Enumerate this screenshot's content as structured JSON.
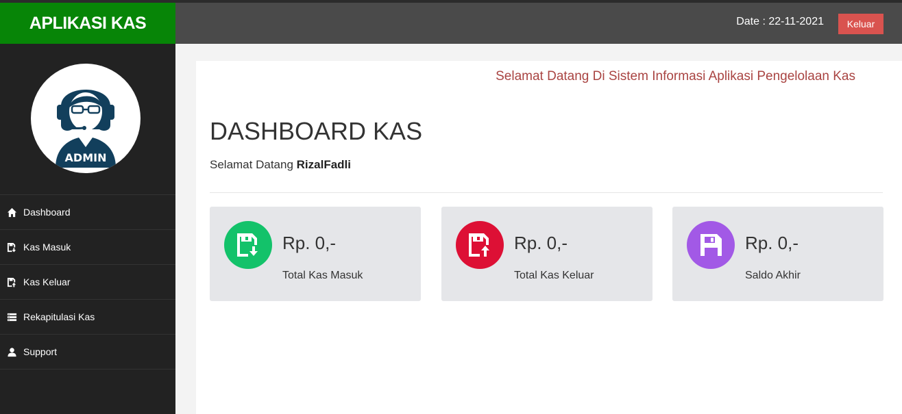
{
  "brand": "APLIKASI KAS",
  "header": {
    "date_text": "Date : 22-11-2021",
    "logout_label": "Keluar"
  },
  "sidebar": {
    "avatar_label": "ADMIN",
    "items": [
      {
        "label": "Dashboard",
        "icon": "home-icon"
      },
      {
        "label": "Kas Masuk",
        "icon": "cash-in-icon"
      },
      {
        "label": "Kas Keluar",
        "icon": "cash-out-icon"
      },
      {
        "label": "Rekapitulasi Kas",
        "icon": "list-icon"
      },
      {
        "label": "Support",
        "icon": "user-icon"
      }
    ]
  },
  "main": {
    "marquee": "Selamat Datang Di Sistem Informasi Aplikasi Pengelolaan Kas",
    "title": "DASHBOARD KAS",
    "welcome_prefix": "Selamat Datang ",
    "username": "RizalFadli",
    "cards": [
      {
        "value": "Rp. 0,-",
        "label": "Total Kas Masuk",
        "icon": "save-download-icon",
        "color": "#13c26a"
      },
      {
        "value": "Rp. 0,-",
        "label": "Total Kas Keluar",
        "icon": "save-upload-icon",
        "color": "#dd1035"
      },
      {
        "value": "Rp. 0,-",
        "label": "Saldo Akhir",
        "icon": "save-icon",
        "color": "#a259e6"
      }
    ]
  },
  "colors": {
    "brand": "#078507",
    "topbar": "#4a4a4a",
    "sidebar": "#222222",
    "logout": "#d9534f",
    "marquee": "#a94442"
  }
}
